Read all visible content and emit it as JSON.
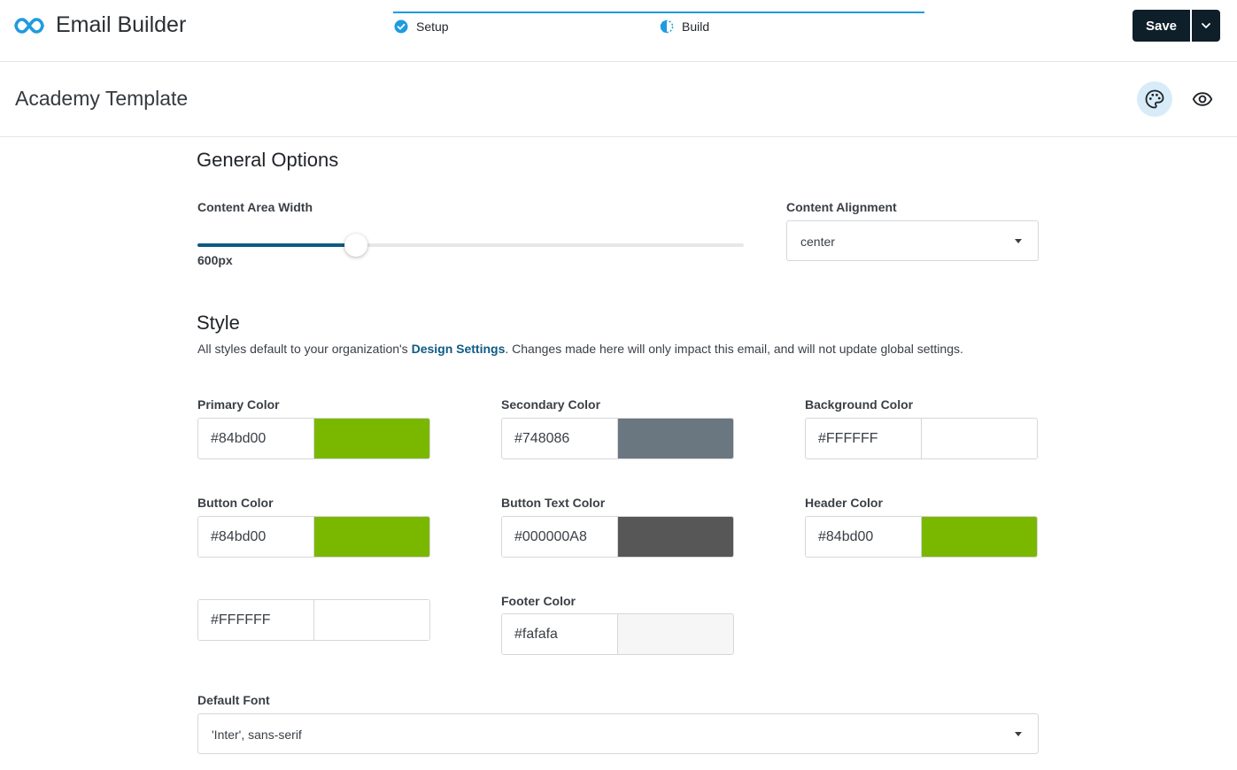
{
  "header": {
    "app_title": "Email Builder",
    "steps": [
      {
        "label": "Setup",
        "icon": "check-circle-icon"
      },
      {
        "label": "Build",
        "icon": "half-circle-icon"
      }
    ],
    "save_label": "Save",
    "accent": "#1e9be0",
    "save_bg": "#0f1f2a"
  },
  "subheader": {
    "template_title": "Academy Template",
    "icons": [
      "palette-icon",
      "eye-icon"
    ]
  },
  "general": {
    "title": "General Options",
    "width_label": "Content Area Width",
    "width_value": "600px",
    "width_fraction": 0.29,
    "alignment_label": "Content Alignment",
    "alignment_value": "center"
  },
  "style": {
    "title": "Style",
    "desc_before": "All styles default to your organization's ",
    "desc_link": "Design Settings",
    "desc_after": ". Changes made here will only impact this email, and will not update global settings.",
    "colors": [
      {
        "label": "Primary Color",
        "value": "#84bd00",
        "swatch": "#7ab800"
      },
      {
        "label": "Secondary Color",
        "value": "#748086",
        "swatch": "#6b7780"
      },
      {
        "label": "Background Color",
        "value": "#FFFFFF",
        "swatch": "#ffffff"
      },
      {
        "label": "Button Color",
        "value": "#84bd00",
        "swatch": "#7ab800"
      },
      {
        "label": "Button Text Color",
        "value": "#000000A8",
        "swatch": "#575757"
      },
      {
        "label": "Header Color",
        "value": "#84bd00",
        "swatch": "#7ab800"
      },
      {
        "label": "",
        "value": "#FFFFFF",
        "swatch": "#ffffff"
      },
      {
        "label": "Footer Color",
        "value": "#fafafa",
        "swatch": "#f6f6f6"
      }
    ],
    "font_label": "Default Font",
    "font_value": "'Inter', sans-serif"
  }
}
